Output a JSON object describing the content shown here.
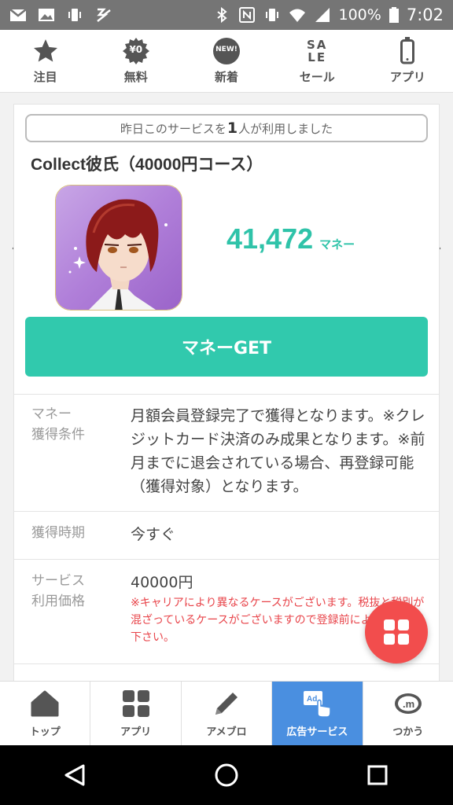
{
  "status_bar": {
    "battery": "100%",
    "time": "7:02"
  },
  "top_nav": {
    "items": [
      {
        "label": "注目",
        "icon": "star-icon"
      },
      {
        "label": "無料",
        "icon": "free-badge-icon",
        "badge": "¥0"
      },
      {
        "label": "新着",
        "icon": "new-badge-icon",
        "badge": "NEW!"
      },
      {
        "label": "セール",
        "icon": "sale-icon",
        "badge": "SALE"
      },
      {
        "label": "アプリ",
        "icon": "phone-icon"
      }
    ]
  },
  "card": {
    "banner_prefix": "昨日このサービスを",
    "banner_count": "1",
    "banner_suffix": "人が利用しました",
    "title": "Collect彼氏（40000円コース）",
    "reward_value": "41,472",
    "reward_unit": "マネー",
    "get_button": "マネーGET",
    "details": {
      "condition_label": "マネー\n獲得条件",
      "condition_value": "月額会員登録完了で獲得となります。※クレジットカード決済のみ成果となります。※前月までに退会されている場合、再登録可能（獲得対象）となります。",
      "timing_label": "獲得時期",
      "timing_value": "今すぐ",
      "price_label": "サービス\n利用価格",
      "price_value": "40000円",
      "price_note": "※キャリアにより異なるケースがございます。税抜と税別が混ざっているケースがございますので登録前によくご確認下さい。"
    }
  },
  "bottom_bar": {
    "tabs": [
      {
        "label": "トップ",
        "icon": "home-icon"
      },
      {
        "label": "アプリ",
        "icon": "apps-grid-icon"
      },
      {
        "label": "アメブロ",
        "icon": "pencil-icon"
      },
      {
        "label": "広告サービス",
        "icon": "ad-tap-icon",
        "active": true
      },
      {
        "label": "つかう",
        "icon": "money-coin-icon"
      }
    ]
  },
  "colors": {
    "accent": "#31c9ad",
    "fab": "#f24d4d",
    "active_tab": "#4a8fe0",
    "note": "#e8444a"
  }
}
